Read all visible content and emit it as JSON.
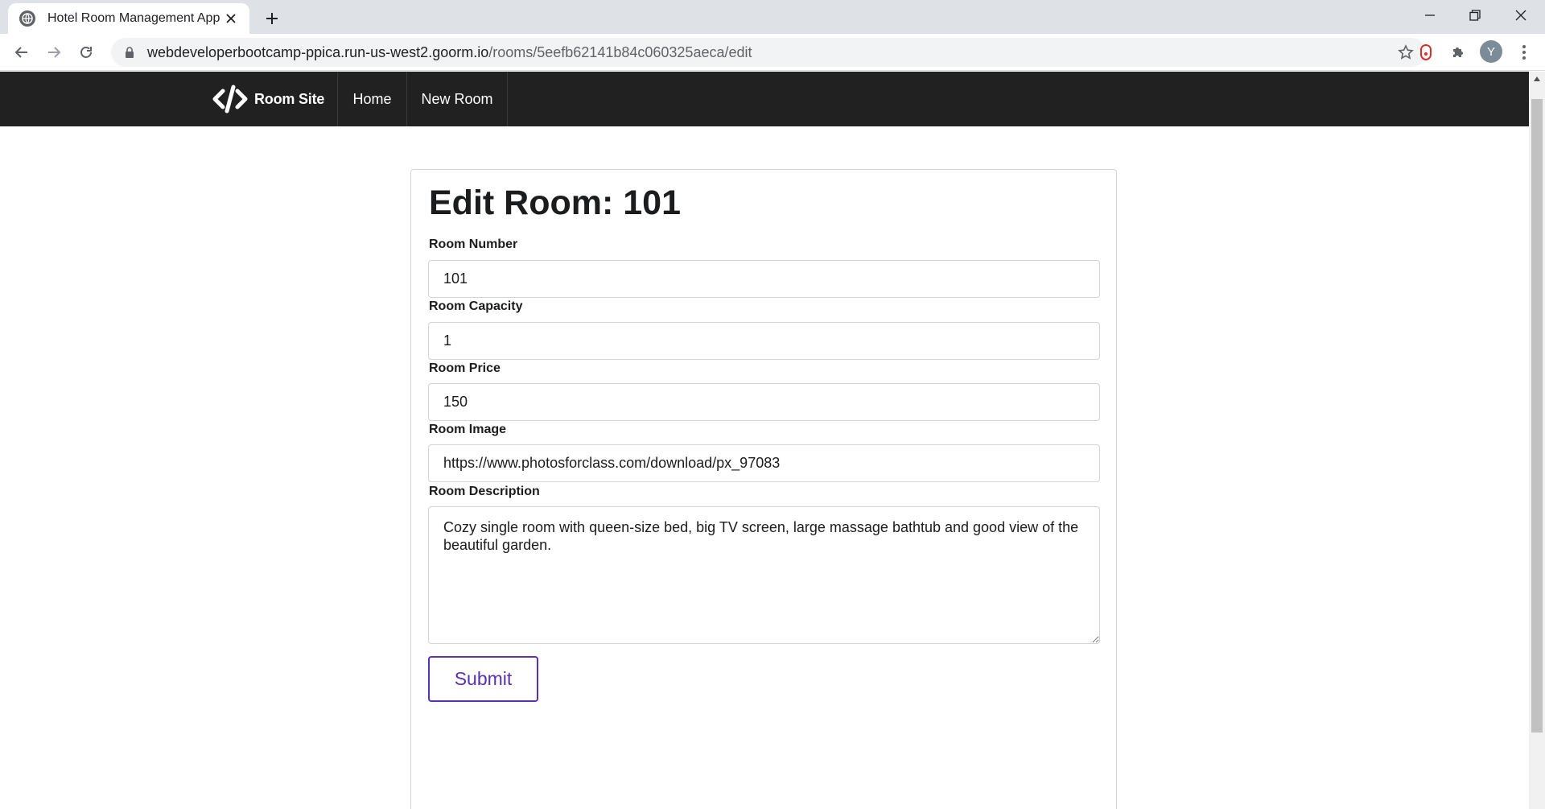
{
  "browser": {
    "tab_title": "Hotel Room Management App",
    "url_host": "webdeveloperbootcamp-ppica.run-us-west2.goorm.io",
    "url_path": "/rooms/5eefb62141b84c060325aeca/edit",
    "profile_initial": "Y"
  },
  "navbar": {
    "brand": "Room Site",
    "links": [
      "Home",
      "New Room"
    ]
  },
  "form": {
    "title": "Edit Room: 101",
    "fields": {
      "number": {
        "label": "Room Number",
        "value": "101"
      },
      "capacity": {
        "label": "Room Capacity",
        "value": "1"
      },
      "price": {
        "label": "Room Price",
        "value": "150"
      },
      "image": {
        "label": "Room Image",
        "value": "https://www.photosforclass.com/download/px_97083"
      },
      "description": {
        "label": "Room Description",
        "value": "Cozy single room with queen-size bed, big TV screen, large massage bathtub and good view of the beautiful garden."
      }
    },
    "submit_label": "Submit"
  },
  "colors": {
    "navbar_bg": "#212121",
    "accent": "#5a30b5"
  }
}
